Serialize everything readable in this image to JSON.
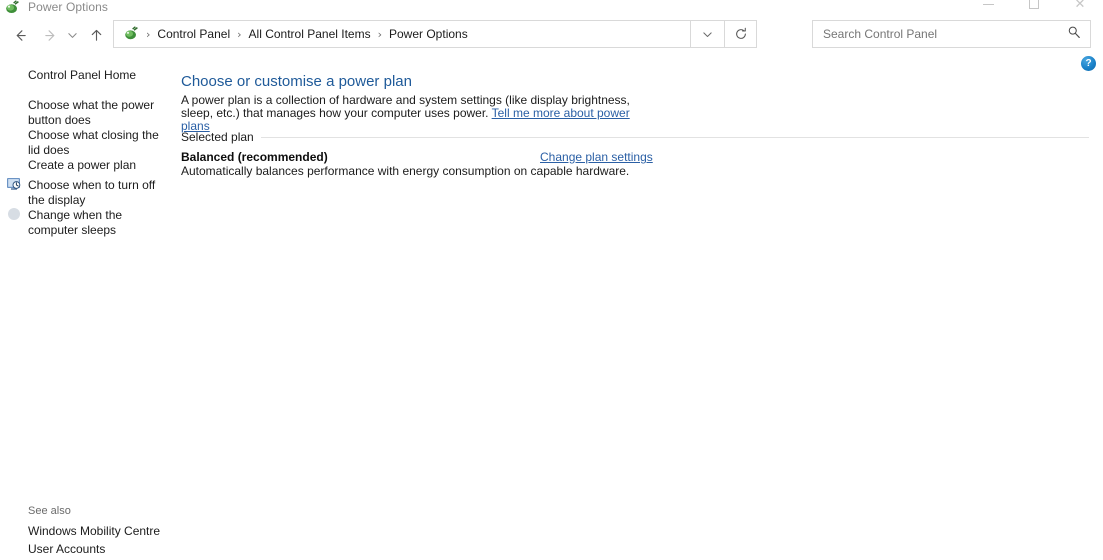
{
  "window": {
    "title": "Power Options",
    "icon": "power-plug-icon",
    "controls": {
      "minimize": "─",
      "maximize": "□",
      "close": "✕"
    }
  },
  "nav": {
    "back": "←",
    "forward": "→",
    "recent": "⌄",
    "up": "↑",
    "dropdown": "⌄",
    "refresh": "↻",
    "breadcrumb_icon": "power-plug-icon",
    "separator": "›",
    "breadcrumbs": [
      "Control Panel",
      "All Control Panel Items",
      "Power Options"
    ]
  },
  "search": {
    "placeholder": "Search Control Panel",
    "value": "",
    "icon": "search-icon"
  },
  "help": {
    "label": "?"
  },
  "sidebar": {
    "home": "Control Panel Home",
    "items": [
      {
        "label": "Choose what the power button does",
        "icon": null
      },
      {
        "label": "Choose what closing the lid does",
        "icon": null
      },
      {
        "label": "Create a power plan",
        "icon": null
      },
      {
        "label": "Choose when to turn off the display",
        "icon": "display-clock-icon"
      },
      {
        "label": "Change when the computer sleeps",
        "icon": "sleep-moon-icon"
      }
    ],
    "see_also_label": "See also",
    "see_also": [
      "Windows Mobility Centre",
      "User Accounts"
    ]
  },
  "main": {
    "title": "Choose or customise a power plan",
    "description_part1": "A power plan is a collection of hardware and system settings (like display brightness, sleep, etc.) that manages how your computer uses power. ",
    "description_link": "Tell me more about power plans",
    "section_label": "Selected plan",
    "plan_name": "Balanced (recommended)",
    "plan_link": "Change plan settings",
    "plan_description": "Automatically balances performance with energy consumption on capable hardware."
  },
  "colors": {
    "heading": "#1f5a99",
    "link": "#2a5fa5",
    "text": "#1c1c1c",
    "help_badge": "#1b82c9",
    "border": "#d9d9d9"
  }
}
